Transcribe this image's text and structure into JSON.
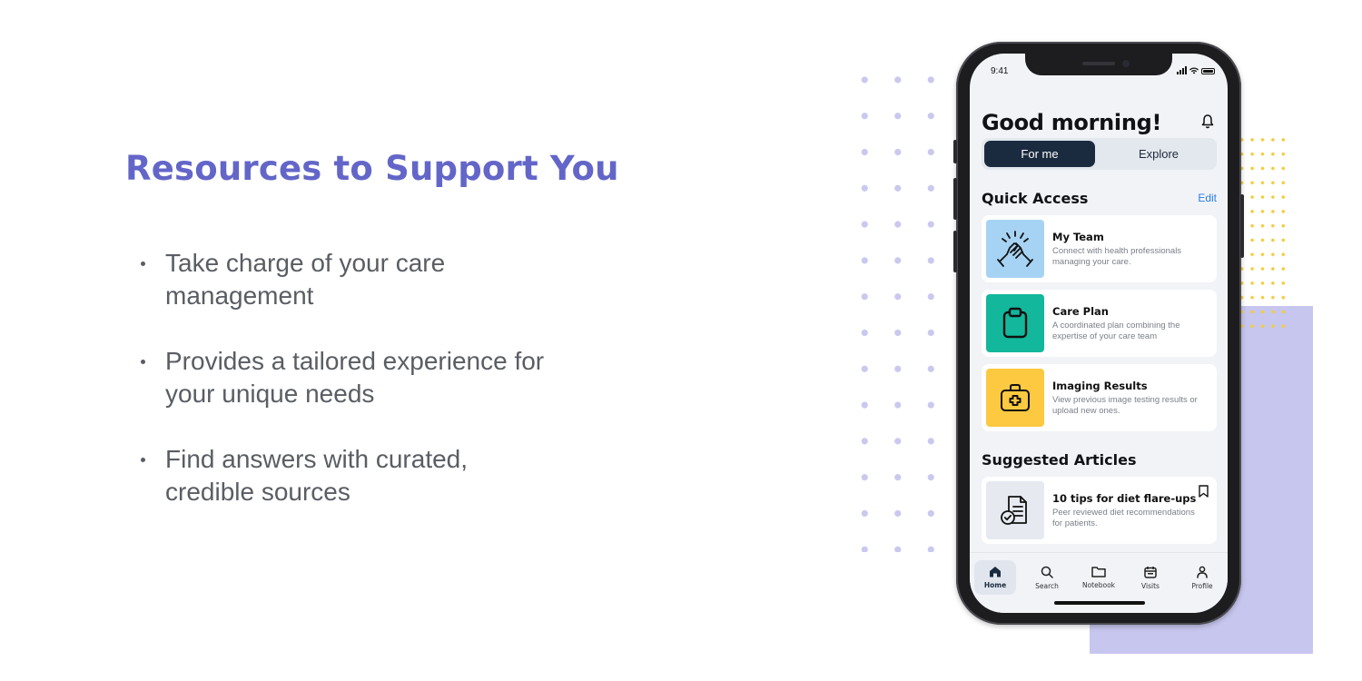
{
  "headline": "Resources to Support You",
  "bullets": [
    "Take charge of your care management",
    "Provides a tailored experience for your unique needs",
    "Find answers with curated, credible sources"
  ],
  "phone": {
    "status_time": "9:41",
    "greeting": "Good morning!",
    "segment": {
      "active": "For me",
      "inactive": "Explore"
    },
    "quick_access": {
      "title": "Quick Access",
      "edit": "Edit",
      "cards": [
        {
          "title": "My Team",
          "desc": "Connect with health professionals managing your care.",
          "icon": "high-five-icon",
          "color": "#a6d3f3"
        },
        {
          "title": "Care Plan",
          "desc": "A coordinated plan combining the expertise of your care team",
          "icon": "clipboard-icon",
          "color": "#13b79b"
        },
        {
          "title": "Imaging Results",
          "desc": "View previous image testing results or upload new ones.",
          "icon": "medical-kit-icon",
          "color": "#fcc940"
        }
      ]
    },
    "articles": {
      "title": "Suggested Articles",
      "items": [
        {
          "title": "10 tips for diet flare-ups",
          "desc": "Peer reviewed diet recommendations for patients.",
          "icon": "document-check-icon"
        }
      ]
    },
    "tabs": [
      {
        "label": "Home",
        "icon": "home-icon",
        "active": true
      },
      {
        "label": "Search",
        "icon": "search-icon",
        "active": false
      },
      {
        "label": "Notebook",
        "icon": "folder-icon",
        "active": false
      },
      {
        "label": "Visits",
        "icon": "calendar-icon",
        "active": false
      },
      {
        "label": "Profile",
        "icon": "person-icon",
        "active": false
      }
    ]
  },
  "colors": {
    "headline": "#6366c8",
    "body_text": "#5a5d63",
    "decor_dots": "#c9c8ef",
    "decor_block": "#c7c6ee",
    "accent_yellow": "#f2cd3d",
    "segment_active": "#1b2b3f",
    "link": "#2b7de0"
  }
}
